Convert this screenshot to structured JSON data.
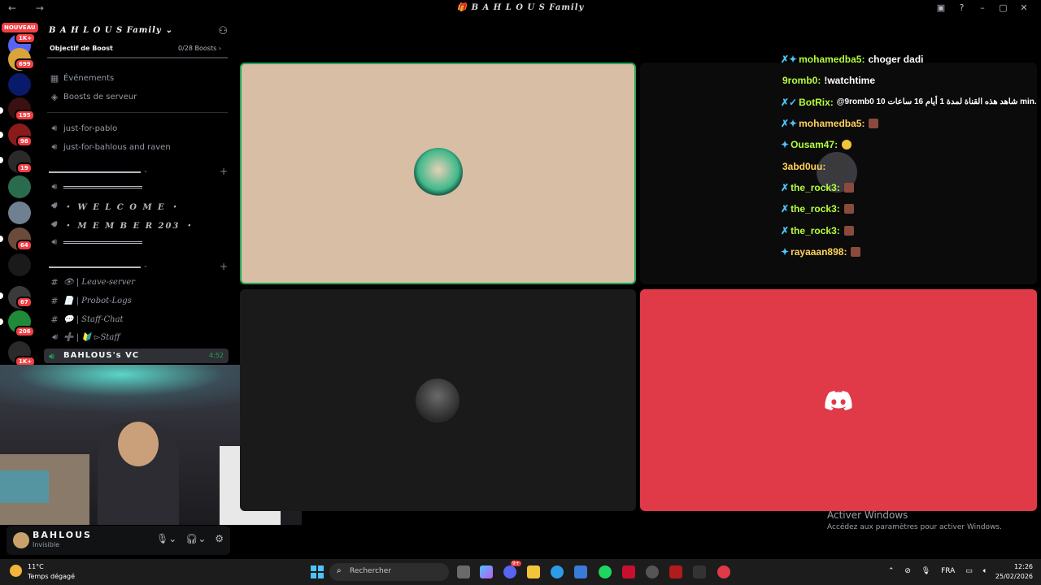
{
  "window": {
    "title": "🎁 B A H L O U S Family"
  },
  "rail": {
    "nouveau": "NOUVEAU",
    "badges": [
      "1K+",
      "699",
      "195",
      "98",
      "19",
      "64",
      "67",
      "206",
      "1K+"
    ]
  },
  "server": {
    "name": "B A H L O U S Family",
    "boost_label": "Objectif de Boost",
    "boost_count": "0/28 Boosts"
  },
  "sidebar": {
    "events": "Événements",
    "server_boosts": "Boosts de serveur",
    "channels_top": [
      "just-for-pablo",
      "just-for-bahlous and raven"
    ],
    "welcome": "・ W E L C O M E ・",
    "member": "・ M E M B E R 203 ・",
    "leave": "👁 | Leave-server",
    "probot": "📄 | Probot-Logs",
    "staffchat": "💬 | Staff-Chat",
    "staff": "➕ | 🔰 ▻Staff",
    "active_vc": "BAHLOUS's VC",
    "active_vc_time": "4:52"
  },
  "user": {
    "name": "BAHLOUS",
    "status": "Invisible"
  },
  "chat": [
    {
      "user": "mohamedba5:",
      "msg": "choger dadi",
      "color": "u1",
      "pre": "✗✦"
    },
    {
      "user": "9romb0:",
      "msg": "!watchtime",
      "color": "u1",
      "pre": ""
    },
    {
      "user": "BotRix:",
      "msg": "@9romb0 شاهد هذه القناة لمدة 1 أيام 16 ساعات 10 min.",
      "color": "u1",
      "pre": "✗✓"
    },
    {
      "user": "mohamedba5:",
      "msg": "",
      "color": "u2",
      "pre": "✗✦"
    },
    {
      "user": "Ousam47:",
      "msg": "",
      "color": "u1",
      "pre": "✦"
    },
    {
      "user": "3abd0uu:",
      "msg": "",
      "color": "u2",
      "pre": ""
    },
    {
      "user": "the_rock3:",
      "msg": "",
      "color": "u1",
      "pre": "✗"
    },
    {
      "user": "the_rock3:",
      "msg": "",
      "color": "u1",
      "pre": "✗"
    },
    {
      "user": "the_rock3:",
      "msg": "",
      "color": "u1",
      "pre": "✗"
    },
    {
      "user": "rayaaan898:",
      "msg": "",
      "color": "u2",
      "pre": "✦"
    }
  ],
  "activate": {
    "title": "Activer Windows",
    "sub": "Accédez aux paramètres pour activer Windows."
  },
  "taskbar": {
    "temp": "11°C",
    "weather": "Temps dégagé",
    "search": "Rechercher",
    "lang": "FRA",
    "time": "12:26",
    "date": "25/02/2026",
    "discord_badge": "9+"
  },
  "colors": {
    "accent_green": "#23a55a",
    "discord_red": "#e03948",
    "tile_beige": "#d7bea4"
  }
}
